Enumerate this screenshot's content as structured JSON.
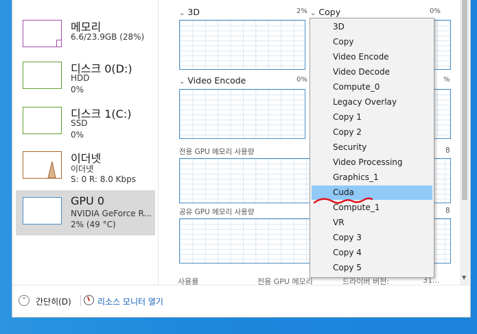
{
  "sidebar": {
    "items": [
      {
        "title": "메모리",
        "sub1": "6.6/23.9GB (28%)",
        "sub2": "",
        "color": "#a44ba6"
      },
      {
        "title": "디스크 0(D:)",
        "sub1": "HDD",
        "sub2": "0%",
        "color": "#5ea02e"
      },
      {
        "title": "디스크 1(C:)",
        "sub1": "SSD",
        "sub2": "0%",
        "color": "#5ea02e"
      },
      {
        "title": "이더넷",
        "sub1": "이더넷",
        "sub2": "S: 0 R: 8.0 Kbps",
        "color": "#a7662b"
      },
      {
        "title": "GPU 0",
        "sub1": "NVIDIA GeForce R...",
        "sub2": "2% (49 °C)",
        "color": "#4a8ec6"
      }
    ]
  },
  "engines": {
    "e1": {
      "name": "3D",
      "pct": "2%"
    },
    "e2": {
      "name": "Copy",
      "pct": "0%"
    },
    "e3": {
      "name": "Video Encode",
      "pct": "0%"
    },
    "e4_pct": "%"
  },
  "labels": {
    "dedicated": "전용 GPU 메모리 사용량",
    "shared": "공유 GPU 메모리 사용량",
    "right_dedicated": "8",
    "right_shared": "8"
  },
  "bottom": {
    "usage": "사용률",
    "dedicated_mem": "전용 GPU 메모리",
    "driver_version": "드라이버 버전:",
    "driver_value": "31..."
  },
  "dropdown": {
    "options": [
      "3D",
      "Copy",
      "Video Encode",
      "Video Decode",
      "Compute_0",
      "Legacy Overlay",
      "Copy 1",
      "Copy 2",
      "Security",
      "Video Processing",
      "Graphics_1",
      "Cuda",
      "Compute_1",
      "VR",
      "Copy 3",
      "Copy 4",
      "Copy 5"
    ],
    "highlighted": "Cuda"
  },
  "footer": {
    "collapse": "간단히(D)",
    "resource_monitor": "리소스 모니터 열기"
  },
  "colors": {
    "accent": "#4a8ec6",
    "highlight": "#91c9f7",
    "annotation": "#e0141e"
  }
}
